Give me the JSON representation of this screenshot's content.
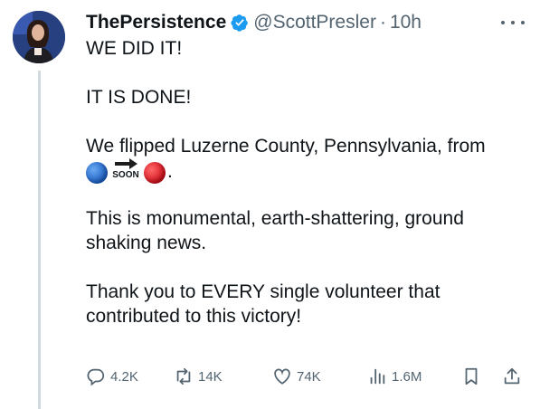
{
  "tweet": {
    "display_name": "ThePersistence",
    "handle": "@ScottPresler",
    "separator": "·",
    "time": "10h",
    "verified_icon": "verified-badge-icon",
    "text": {
      "p1": "WE DID IT!",
      "p2": "IT IS DONE!",
      "p3": "We flipped Luzerne County, Pennsylvania, from",
      "emoji_sequence": [
        "blue-circle-emoji",
        "soon-arrow-emoji",
        "red-circle-emoji"
      ],
      "soon_label": "SOON",
      "p3_end": ".",
      "p4": "This is monumental, earth-shattering, ground shaking news.",
      "p5": "Thank you to EVERY single volunteer that contributed to this victory!"
    },
    "actions": {
      "replies": "4.2K",
      "retweets": "14K",
      "likes": "74K",
      "views": "1.6M"
    }
  },
  "colors": {
    "text": "#0f1419",
    "muted": "#536471",
    "verified": "#1d9bf0",
    "thread_line": "#cfd9de"
  }
}
